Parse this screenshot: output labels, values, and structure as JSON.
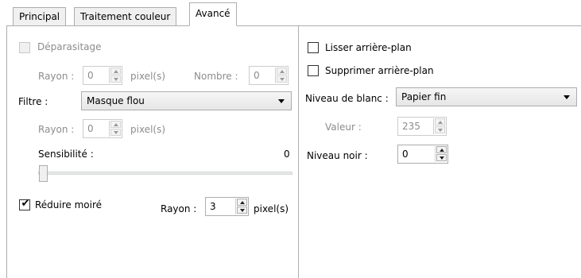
{
  "tabs": [
    {
      "label": "Principal"
    },
    {
      "label": "Traitement couleur"
    },
    {
      "label": "Avancé"
    }
  ],
  "left": {
    "deparasitage": {
      "label": "Déparasitage",
      "checked": false
    },
    "rayon1": {
      "label": "Rayon :",
      "value": "0",
      "unit": "pixel(s)"
    },
    "nombre": {
      "label": "Nombre :",
      "value": "0"
    },
    "filtre": {
      "label": "Filtre :",
      "value": "Masque flou"
    },
    "rayon2": {
      "label": "Rayon :",
      "value": "0",
      "unit": "pixel(s)"
    },
    "sensibilite": {
      "label": "Sensibilité :",
      "value": "0",
      "level": 0
    },
    "moire": {
      "label": "Réduire moiré",
      "checked": true,
      "check_mark": "✔"
    },
    "rayon3": {
      "label": "Rayon :",
      "value": "3",
      "unit": "pixel(s)"
    }
  },
  "right": {
    "lisser": {
      "label": "Lisser arrière-plan",
      "checked": false
    },
    "supprimer": {
      "label": "Supprimer arrière-plan",
      "checked": false
    },
    "niveau_blanc": {
      "label": "Niveau de blanc :",
      "value": "Papier fin"
    },
    "valeur": {
      "label": "Valeur :",
      "value": "235"
    },
    "niveau_noir": {
      "label": "Niveau noir :",
      "value": "0"
    }
  }
}
